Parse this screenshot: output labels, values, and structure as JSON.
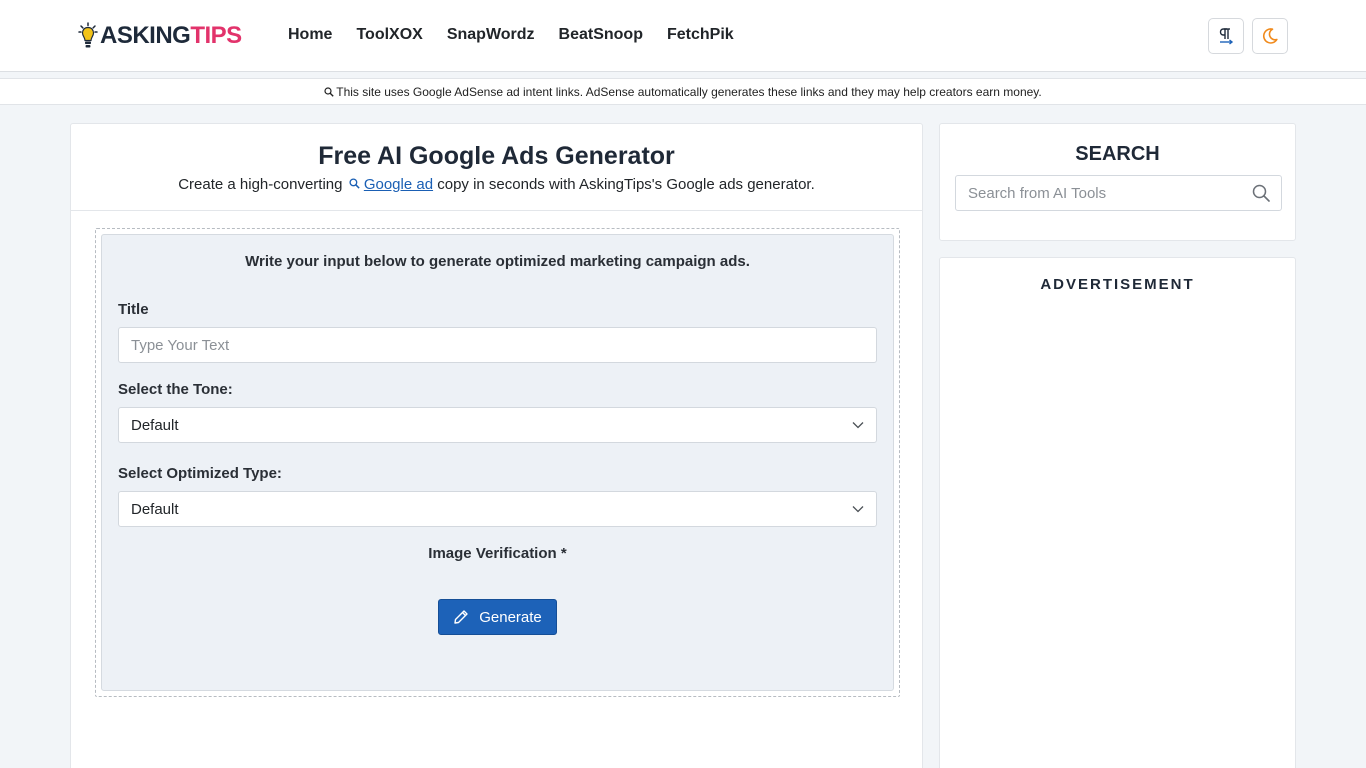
{
  "header": {
    "logo_part1": "ASKING",
    "logo_part2": "TIPS",
    "nav": [
      "Home",
      "ToolXOX",
      "SnapWordz",
      "BeatSnoop",
      "FetchPik"
    ],
    "lang_icon": "paragraph-icon",
    "theme_icon": "moon-icon"
  },
  "notice": {
    "text": "This site uses Google AdSense ad intent links. AdSense automatically generates these links and they may help creators earn money."
  },
  "main": {
    "title": "Free AI Google Ads Generator",
    "sub_before": "Create a high-converting",
    "sub_link": "Google ad",
    "sub_after": "copy in seconds with AskingTips's Google ads generator.",
    "intro": "Write your input below to generate optimized marketing campaign ads.",
    "title_label": "Title",
    "title_placeholder": "Type Your Text",
    "tone_label": "Select the Tone:",
    "tone_value": "Default",
    "type_label": "Select Optimized Type:",
    "type_value": "Default",
    "verify_label": "Image Verification *",
    "generate_label": "Generate"
  },
  "sidebar": {
    "search_title": "SEARCH",
    "search_placeholder": "Search from AI Tools",
    "ad_title": "ADVERTISEMENT"
  },
  "colors": {
    "brand_dark": "#1e2a3a",
    "brand_pink": "#e2336b",
    "primary": "#1d62b8",
    "moon": "#f08a1c"
  }
}
